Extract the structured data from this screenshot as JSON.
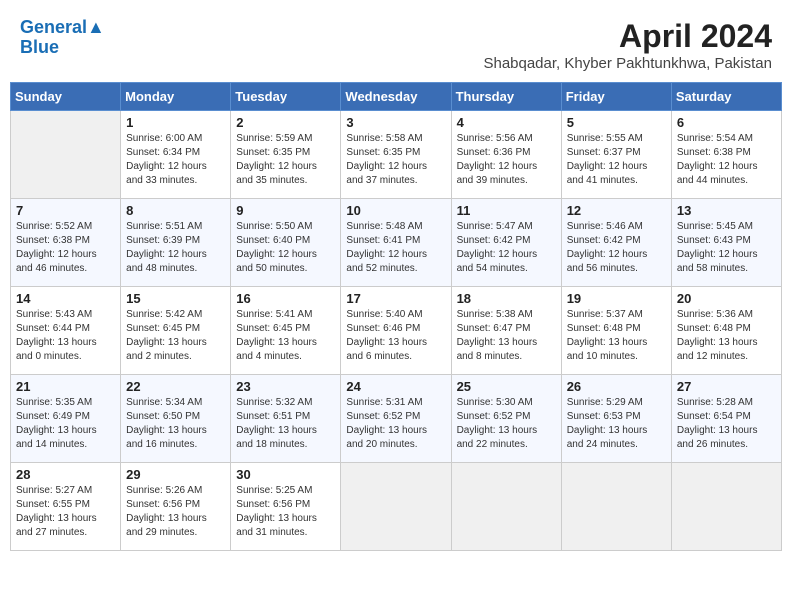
{
  "header": {
    "logo_line1": "General",
    "logo_line2": "Blue",
    "month_year": "April 2024",
    "location": "Shabqadar, Khyber Pakhtunkhwa, Pakistan"
  },
  "weekdays": [
    "Sunday",
    "Monday",
    "Tuesday",
    "Wednesday",
    "Thursday",
    "Friday",
    "Saturday"
  ],
  "weeks": [
    [
      {
        "day": "",
        "sunrise": "",
        "sunset": "",
        "daylight": ""
      },
      {
        "day": "1",
        "sunrise": "Sunrise: 6:00 AM",
        "sunset": "Sunset: 6:34 PM",
        "daylight": "Daylight: 12 hours and 33 minutes."
      },
      {
        "day": "2",
        "sunrise": "Sunrise: 5:59 AM",
        "sunset": "Sunset: 6:35 PM",
        "daylight": "Daylight: 12 hours and 35 minutes."
      },
      {
        "day": "3",
        "sunrise": "Sunrise: 5:58 AM",
        "sunset": "Sunset: 6:35 PM",
        "daylight": "Daylight: 12 hours and 37 minutes."
      },
      {
        "day": "4",
        "sunrise": "Sunrise: 5:56 AM",
        "sunset": "Sunset: 6:36 PM",
        "daylight": "Daylight: 12 hours and 39 minutes."
      },
      {
        "day": "5",
        "sunrise": "Sunrise: 5:55 AM",
        "sunset": "Sunset: 6:37 PM",
        "daylight": "Daylight: 12 hours and 41 minutes."
      },
      {
        "day": "6",
        "sunrise": "Sunrise: 5:54 AM",
        "sunset": "Sunset: 6:38 PM",
        "daylight": "Daylight: 12 hours and 44 minutes."
      }
    ],
    [
      {
        "day": "7",
        "sunrise": "Sunrise: 5:52 AM",
        "sunset": "Sunset: 6:38 PM",
        "daylight": "Daylight: 12 hours and 46 minutes."
      },
      {
        "day": "8",
        "sunrise": "Sunrise: 5:51 AM",
        "sunset": "Sunset: 6:39 PM",
        "daylight": "Daylight: 12 hours and 48 minutes."
      },
      {
        "day": "9",
        "sunrise": "Sunrise: 5:50 AM",
        "sunset": "Sunset: 6:40 PM",
        "daylight": "Daylight: 12 hours and 50 minutes."
      },
      {
        "day": "10",
        "sunrise": "Sunrise: 5:48 AM",
        "sunset": "Sunset: 6:41 PM",
        "daylight": "Daylight: 12 hours and 52 minutes."
      },
      {
        "day": "11",
        "sunrise": "Sunrise: 5:47 AM",
        "sunset": "Sunset: 6:42 PM",
        "daylight": "Daylight: 12 hours and 54 minutes."
      },
      {
        "day": "12",
        "sunrise": "Sunrise: 5:46 AM",
        "sunset": "Sunset: 6:42 PM",
        "daylight": "Daylight: 12 hours and 56 minutes."
      },
      {
        "day": "13",
        "sunrise": "Sunrise: 5:45 AM",
        "sunset": "Sunset: 6:43 PM",
        "daylight": "Daylight: 12 hours and 58 minutes."
      }
    ],
    [
      {
        "day": "14",
        "sunrise": "Sunrise: 5:43 AM",
        "sunset": "Sunset: 6:44 PM",
        "daylight": "Daylight: 13 hours and 0 minutes."
      },
      {
        "day": "15",
        "sunrise": "Sunrise: 5:42 AM",
        "sunset": "Sunset: 6:45 PM",
        "daylight": "Daylight: 13 hours and 2 minutes."
      },
      {
        "day": "16",
        "sunrise": "Sunrise: 5:41 AM",
        "sunset": "Sunset: 6:45 PM",
        "daylight": "Daylight: 13 hours and 4 minutes."
      },
      {
        "day": "17",
        "sunrise": "Sunrise: 5:40 AM",
        "sunset": "Sunset: 6:46 PM",
        "daylight": "Daylight: 13 hours and 6 minutes."
      },
      {
        "day": "18",
        "sunrise": "Sunrise: 5:38 AM",
        "sunset": "Sunset: 6:47 PM",
        "daylight": "Daylight: 13 hours and 8 minutes."
      },
      {
        "day": "19",
        "sunrise": "Sunrise: 5:37 AM",
        "sunset": "Sunset: 6:48 PM",
        "daylight": "Daylight: 13 hours and 10 minutes."
      },
      {
        "day": "20",
        "sunrise": "Sunrise: 5:36 AM",
        "sunset": "Sunset: 6:48 PM",
        "daylight": "Daylight: 13 hours and 12 minutes."
      }
    ],
    [
      {
        "day": "21",
        "sunrise": "Sunrise: 5:35 AM",
        "sunset": "Sunset: 6:49 PM",
        "daylight": "Daylight: 13 hours and 14 minutes."
      },
      {
        "day": "22",
        "sunrise": "Sunrise: 5:34 AM",
        "sunset": "Sunset: 6:50 PM",
        "daylight": "Daylight: 13 hours and 16 minutes."
      },
      {
        "day": "23",
        "sunrise": "Sunrise: 5:32 AM",
        "sunset": "Sunset: 6:51 PM",
        "daylight": "Daylight: 13 hours and 18 minutes."
      },
      {
        "day": "24",
        "sunrise": "Sunrise: 5:31 AM",
        "sunset": "Sunset: 6:52 PM",
        "daylight": "Daylight: 13 hours and 20 minutes."
      },
      {
        "day": "25",
        "sunrise": "Sunrise: 5:30 AM",
        "sunset": "Sunset: 6:52 PM",
        "daylight": "Daylight: 13 hours and 22 minutes."
      },
      {
        "day": "26",
        "sunrise": "Sunrise: 5:29 AM",
        "sunset": "Sunset: 6:53 PM",
        "daylight": "Daylight: 13 hours and 24 minutes."
      },
      {
        "day": "27",
        "sunrise": "Sunrise: 5:28 AM",
        "sunset": "Sunset: 6:54 PM",
        "daylight": "Daylight: 13 hours and 26 minutes."
      }
    ],
    [
      {
        "day": "28",
        "sunrise": "Sunrise: 5:27 AM",
        "sunset": "Sunset: 6:55 PM",
        "daylight": "Daylight: 13 hours and 27 minutes."
      },
      {
        "day": "29",
        "sunrise": "Sunrise: 5:26 AM",
        "sunset": "Sunset: 6:56 PM",
        "daylight": "Daylight: 13 hours and 29 minutes."
      },
      {
        "day": "30",
        "sunrise": "Sunrise: 5:25 AM",
        "sunset": "Sunset: 6:56 PM",
        "daylight": "Daylight: 13 hours and 31 minutes."
      },
      {
        "day": "",
        "sunrise": "",
        "sunset": "",
        "daylight": ""
      },
      {
        "day": "",
        "sunrise": "",
        "sunset": "",
        "daylight": ""
      },
      {
        "day": "",
        "sunrise": "",
        "sunset": "",
        "daylight": ""
      },
      {
        "day": "",
        "sunrise": "",
        "sunset": "",
        "daylight": ""
      }
    ]
  ]
}
